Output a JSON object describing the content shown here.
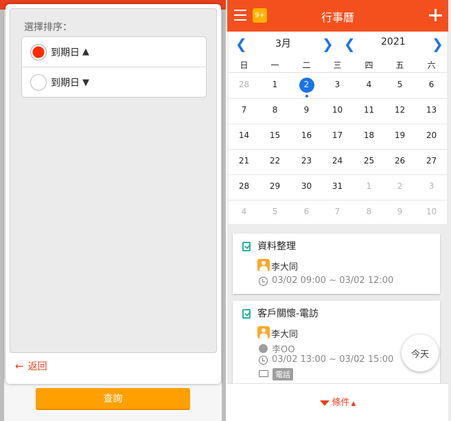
{
  "sort_panel": {
    "label": "選擇排序：",
    "options": [
      {
        "text": "到期日",
        "arrow": "▲",
        "selected": true
      },
      {
        "text": "到期日",
        "arrow": "▼",
        "selected": false
      }
    ],
    "back_arrow": "←",
    "back_label": "返回",
    "query_label": "查詢"
  },
  "header": {
    "badge": "9+",
    "title": "行事曆"
  },
  "calendar": {
    "month": "3月",
    "year": "2021",
    "prev_arrow": "❮",
    "next_arrow": "❯",
    "weekdays": [
      "日",
      "一",
      "二",
      "三",
      "四",
      "五",
      "六"
    ],
    "weeks": [
      [
        {
          "d": "28",
          "m": true
        },
        {
          "d": "1"
        },
        {
          "d": "2",
          "sel": true
        },
        {
          "d": "3"
        },
        {
          "d": "4"
        },
        {
          "d": "5"
        },
        {
          "d": "6"
        }
      ],
      [
        {
          "d": "7"
        },
        {
          "d": "8"
        },
        {
          "d": "9"
        },
        {
          "d": "10"
        },
        {
          "d": "11"
        },
        {
          "d": "12"
        },
        {
          "d": "13"
        }
      ],
      [
        {
          "d": "14"
        },
        {
          "d": "15"
        },
        {
          "d": "16"
        },
        {
          "d": "17"
        },
        {
          "d": "18"
        },
        {
          "d": "19"
        },
        {
          "d": "20"
        }
      ],
      [
        {
          "d": "21"
        },
        {
          "d": "22"
        },
        {
          "d": "23"
        },
        {
          "d": "24"
        },
        {
          "d": "25"
        },
        {
          "d": "26"
        },
        {
          "d": "27"
        }
      ],
      [
        {
          "d": "28"
        },
        {
          "d": "29"
        },
        {
          "d": "30"
        },
        {
          "d": "31"
        },
        {
          "d": "1",
          "m": true
        },
        {
          "d": "2",
          "m": true
        },
        {
          "d": "3",
          "m": true
        }
      ],
      [
        {
          "d": "4",
          "m": true
        },
        {
          "d": "5",
          "m": true
        },
        {
          "d": "6",
          "m": true
        },
        {
          "d": "7",
          "m": true
        },
        {
          "d": "8",
          "m": true
        },
        {
          "d": "9",
          "m": true
        },
        {
          "d": "10",
          "m": true
        }
      ]
    ]
  },
  "events": [
    {
      "title": "資料整理",
      "owner": "李大同",
      "time": "03/02 09:00 ~ 03/02 12:00"
    },
    {
      "title": "客戶關懷-電訪",
      "owner": "李大同",
      "contact": "李OO",
      "time": "03/02 13:00 ~ 03/02 15:00",
      "tag": "電話"
    }
  ],
  "today_label": "今天",
  "filter_label": "條件",
  "filter_caret": "▲",
  "colors": {
    "brand": "#f4501e",
    "accent_orange": "#ffa000",
    "selected_blue": "#1a73e8",
    "task_green": "#21b39b"
  }
}
